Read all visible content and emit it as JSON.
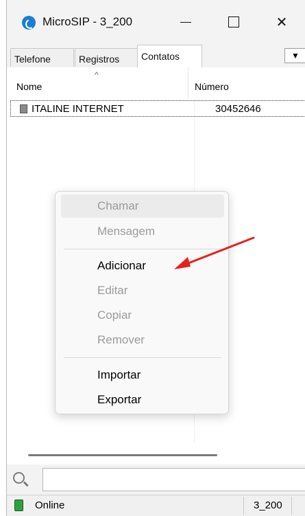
{
  "window": {
    "title": "MicroSIP - 3_200",
    "minimize_label": "—",
    "close_label": "✕"
  },
  "tabs": [
    {
      "label": "Telefone",
      "active": false
    },
    {
      "label": "Registros",
      "active": false
    },
    {
      "label": "Contatos",
      "active": true
    }
  ],
  "tab_dropdown_glyph": "▼",
  "list": {
    "columns": [
      "Nome",
      "Número"
    ],
    "sort_glyph": "^",
    "rows": [
      {
        "name": "ITALINE INTERNET",
        "number": "30452646"
      }
    ]
  },
  "context_menu": {
    "items": [
      {
        "label": "Chamar",
        "enabled": false
      },
      {
        "label": "Mensagem",
        "enabled": false
      },
      {
        "label": "Adicionar",
        "enabled": true
      },
      {
        "label": "Editar",
        "enabled": false
      },
      {
        "label": "Copiar",
        "enabled": false
      },
      {
        "label": "Remover",
        "enabled": false
      },
      {
        "label": "Importar",
        "enabled": true
      },
      {
        "label": "Exportar",
        "enabled": true
      }
    ]
  },
  "annotation": {
    "color": "#e8201c"
  },
  "search": {
    "value": ""
  },
  "status": {
    "text": "Online",
    "account": "3_200",
    "color": "#2ea043"
  }
}
